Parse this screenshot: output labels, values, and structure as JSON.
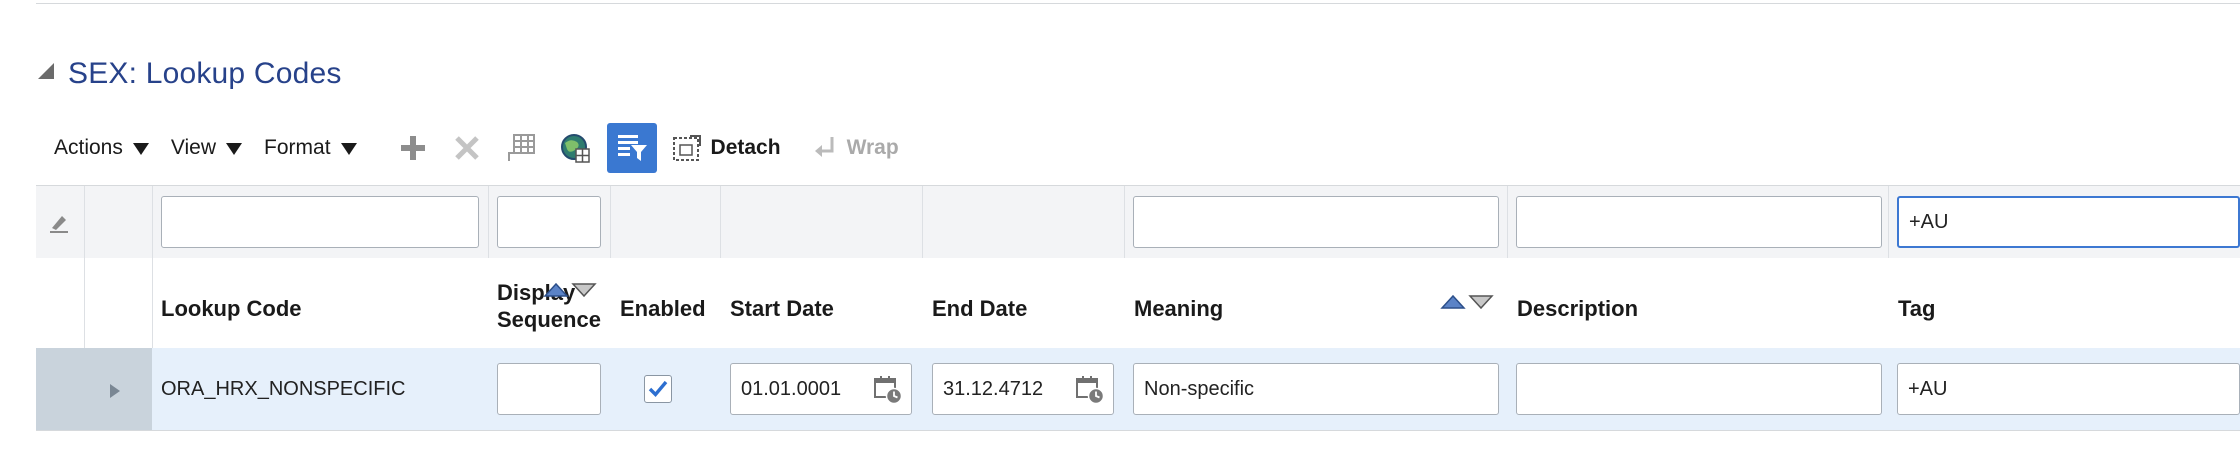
{
  "section": {
    "title": "SEX: Lookup Codes"
  },
  "toolbar": {
    "menus": [
      "Actions",
      "View",
      "Format"
    ],
    "detach_label": "Detach",
    "wrap_label": "Wrap"
  },
  "filters": {
    "lookup_code": "",
    "display_sequence": "",
    "meaning": "",
    "description": "",
    "tag": "+AU"
  },
  "columns": {
    "lookup_code": "Lookup Code",
    "display_sequence_line1": "Display",
    "display_sequence_line2": "Sequence",
    "enabled": "Enabled",
    "start_date": "Start Date",
    "end_date": "End Date",
    "meaning": "Meaning",
    "description": "Description",
    "tag": "Tag"
  },
  "rows": [
    {
      "lookup_code": "ORA_HRX_NONSPECIFIC",
      "display_sequence": "",
      "enabled": true,
      "start_date": "01.01.0001",
      "end_date": "31.12.4712",
      "meaning": "Non-specific",
      "description": "",
      "tag": "+AU"
    }
  ],
  "colors": {
    "accent": "#3a78d1",
    "title": "#27428a",
    "selected_row": "#e6f0fb"
  }
}
